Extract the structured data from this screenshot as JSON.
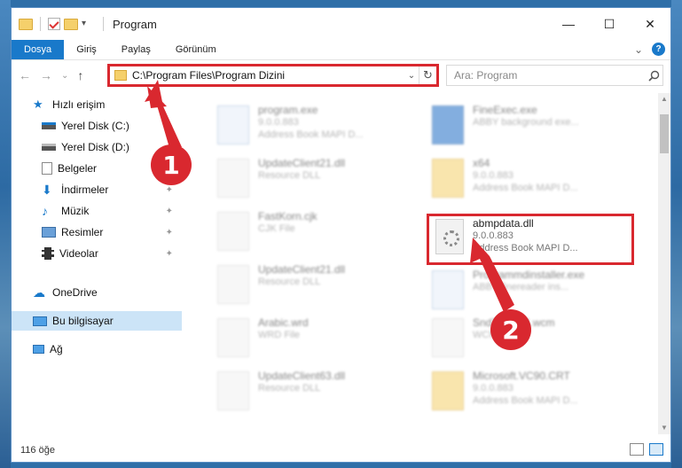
{
  "window": {
    "title": "Program",
    "controls": {
      "minimize": "—",
      "maximize": "☐",
      "close": "✕"
    }
  },
  "ribbon": {
    "tabs": [
      "Dosya",
      "Giriş",
      "Paylaş",
      "Görünüm"
    ],
    "collapse_glyph": "⌄",
    "help_glyph": "?"
  },
  "nav": {
    "back": "←",
    "forward": "→",
    "recent": "⌄",
    "up": "↑"
  },
  "address": {
    "path": "C:\\Program Files\\Program Dizini",
    "dropdown_glyph": "⌄",
    "refresh_glyph": "↻"
  },
  "search": {
    "placeholder": "Ara: Program",
    "icon": "search-icon"
  },
  "sidebar": {
    "items": [
      {
        "label": "Hızlı erişim",
        "icon": "star-icon",
        "pinned": false
      },
      {
        "label": "Yerel Disk (C:)",
        "icon": "drive-icon",
        "pinned": true
      },
      {
        "label": "Yerel Disk (D:)",
        "icon": "drive-icon",
        "pinned": true
      },
      {
        "label": "Belgeler",
        "icon": "documents-icon",
        "pinned": true
      },
      {
        "label": "İndirmeler",
        "icon": "download-icon",
        "pinned": true
      },
      {
        "label": "Müzik",
        "icon": "music-icon",
        "pinned": true
      },
      {
        "label": "Resimler",
        "icon": "pictures-icon",
        "pinned": true
      },
      {
        "label": "Videolar",
        "icon": "video-icon",
        "pinned": true
      },
      {
        "label": "OneDrive",
        "icon": "cloud-icon",
        "pinned": false
      },
      {
        "label": "Bu bilgisayar",
        "icon": "computer-icon",
        "pinned": false,
        "selected": true
      },
      {
        "label": "Ağ",
        "icon": "network-icon",
        "pinned": false
      }
    ],
    "pin_glyph": "📌"
  },
  "files": [
    {
      "name": "program.exe",
      "line2": "9.0.0.883",
      "line3": "Address Book MAPI D...",
      "kind": "exe",
      "blurred": true
    },
    {
      "name": "FineExec.exe",
      "line2": "ABBY background exe...",
      "line3": "",
      "kind": "blue",
      "blurred": true
    },
    {
      "name": "UpdateClient21.dll",
      "line2": "Resource DLL",
      "line3": "",
      "kind": "doc",
      "blurred": true
    },
    {
      "name": "x64",
      "line2": "9.0.0.883",
      "line3": "Address Book MAPI D...",
      "kind": "folder",
      "blurred": true
    },
    {
      "name": "FastKorn.cjk",
      "line2": "CJK File",
      "line3": "",
      "kind": "doc",
      "blurred": true
    },
    {
      "name": "abmpdata.dll",
      "line2": "9.0.0.883",
      "line3": "Address Book MAPI D...",
      "kind": "dll",
      "blurred": false
    },
    {
      "name": "UpdateClient21.dll",
      "line2": "Resource DLL",
      "line3": "",
      "kind": "doc",
      "blurred": true
    },
    {
      "name": "Programmdinstaller.exe",
      "line2": "ABBY finereader ins...",
      "line3": "",
      "kind": "exe",
      "blurred": true
    },
    {
      "name": "Arabic.wrd",
      "line2": "WRD File",
      "line3": "",
      "kind": "doc",
      "blurred": true
    },
    {
      "name": "SndTO2604.wcm",
      "line2": "WCM File",
      "line3": "",
      "kind": "doc",
      "blurred": true
    },
    {
      "name": "UpdateClient63.dll",
      "line2": "Resource DLL",
      "line3": "",
      "kind": "doc",
      "blurred": true
    },
    {
      "name": "Microsoft.VC90.CRT",
      "line2": "9.0.0.883",
      "line3": "Address Book MAPI D...",
      "kind": "folder",
      "blurred": true
    }
  ],
  "status": {
    "item_count": "116 öğe"
  },
  "annotations": {
    "step1": "1",
    "step2": "2",
    "color": "#d9282f"
  }
}
